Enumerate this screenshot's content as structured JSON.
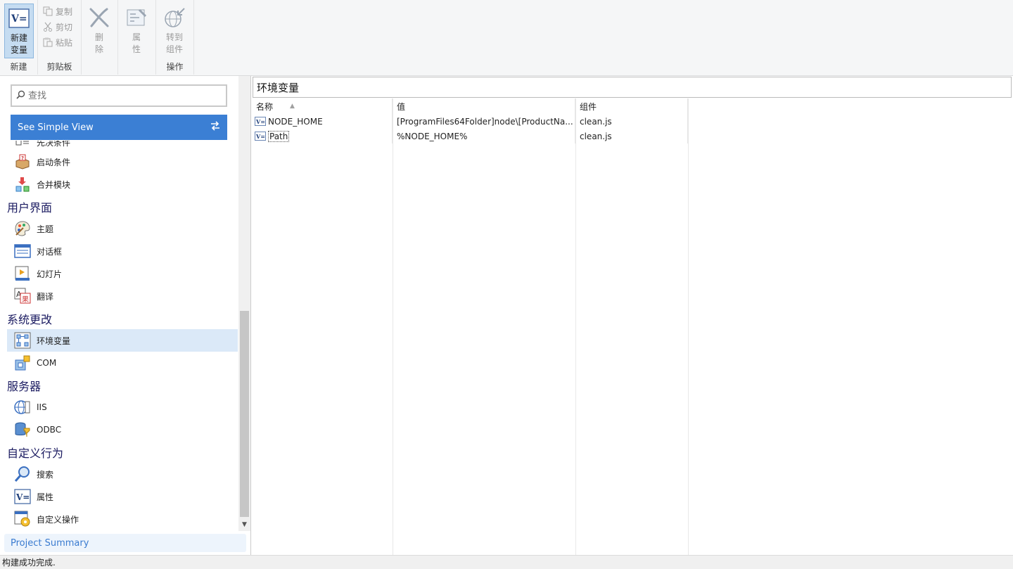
{
  "ribbon": {
    "groups": {
      "new": {
        "label": "新建",
        "new_variable": "新建\n变量"
      },
      "clipboard": {
        "label": "剪贴板",
        "copy": "复制",
        "cut": "剪切",
        "paste": "粘贴"
      },
      "delete": {
        "label": "删\n除"
      },
      "properties": {
        "label": "属\n性"
      },
      "operations": {
        "label": "操作",
        "goto_component": "转到\n组件"
      }
    }
  },
  "sidebar": {
    "search_placeholder": "查找",
    "simple_view": "See Simple View",
    "cut_item": "先决条件",
    "items_top": [
      {
        "label": "启动条件",
        "icon": "launch-condition-icon"
      },
      {
        "label": "合并模块",
        "icon": "merge-module-icon"
      }
    ],
    "categories": [
      {
        "title": "用户界面",
        "items": [
          {
            "label": "主题",
            "icon": "theme-palette-icon"
          },
          {
            "label": "对话框",
            "icon": "dialog-icon"
          },
          {
            "label": "幻灯片",
            "icon": "slideshow-icon"
          },
          {
            "label": "翻译",
            "icon": "translation-icon"
          }
        ]
      },
      {
        "title": "系统更改",
        "items": [
          {
            "label": "环境变量",
            "icon": "environment-variables-icon",
            "selected": true
          },
          {
            "label": "COM",
            "icon": "com-icon"
          }
        ]
      },
      {
        "title": "服务器",
        "items": [
          {
            "label": "IIS",
            "icon": "iis-globe-icon"
          },
          {
            "label": "ODBC",
            "icon": "odbc-database-icon"
          }
        ]
      },
      {
        "title": "自定义行为",
        "items": [
          {
            "label": "搜索",
            "icon": "search-magnifier-icon"
          },
          {
            "label": "属性",
            "icon": "property-icon"
          },
          {
            "label": "自定义操作",
            "icon": "custom-action-icon"
          }
        ]
      }
    ],
    "project_summary": "Project Summary"
  },
  "main": {
    "title": "环境变量",
    "columns": [
      "名称",
      "值",
      "组件"
    ],
    "rows": [
      {
        "name": "NODE_HOME",
        "value": "[ProgramFiles64Folder]node\\[ProductNa...",
        "component": "clean.js"
      },
      {
        "name": "Path",
        "value": "%NODE_HOME%",
        "component": "clean.js"
      }
    ]
  },
  "status": {
    "text": "构建成功完成."
  },
  "colors": {
    "accent": "#3b7fd4",
    "selected": "#dbe9f8",
    "category_text": "#1a1a60",
    "top_accent": "#f0a070"
  }
}
